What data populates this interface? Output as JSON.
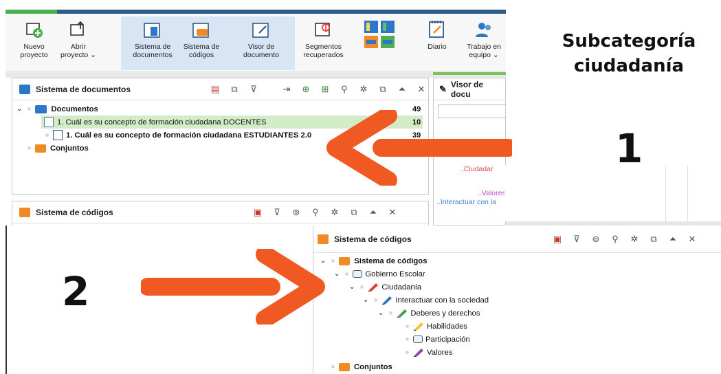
{
  "ribbon": {
    "buttons": [
      {
        "label_1": "Nuevo",
        "label_2": "proyecto",
        "icon": "new-project-icon"
      },
      {
        "label_1": "Abrir",
        "label_2": "proyecto ⌄",
        "icon": "open-project-icon"
      },
      {
        "label_1": "Sistema de",
        "label_2": "documentos",
        "icon": "document-system-icon"
      },
      {
        "label_1": "Sistema de",
        "label_2": "códigos",
        "icon": "code-system-icon"
      },
      {
        "label_1": "Visor de",
        "label_2": "documento",
        "icon": "document-browser-icon"
      },
      {
        "label_1": "Segmentos",
        "label_2": "recuperados",
        "icon": "retrieved-segments-icon"
      },
      {
        "label_1": "",
        "label_2": "",
        "icon": "layout-grid-icon"
      },
      {
        "label_1": "Diario",
        "label_2": "",
        "icon": "logbook-icon"
      },
      {
        "label_1": "Trabajo en",
        "label_2": "equipo ⌄",
        "icon": "teamwork-icon"
      }
    ]
  },
  "doc_panel": {
    "title": "Sistema de documentos",
    "root": {
      "label": "Documentos",
      "count": "49"
    },
    "docs": [
      {
        "label": "1. Cuál es su concepto de formación ciudadana DOCENTES",
        "count": "10"
      },
      {
        "label": "1. Cuál es su concepto de formación ciudadana ESTUDIANTES 2.0",
        "count": "39"
      }
    ],
    "sets": "Conjuntos"
  },
  "viewer_panel": {
    "title": "Visor de docu",
    "snippets": [
      "..Ciudadar",
      "..Valores",
      "..Interactuar con la"
    ]
  },
  "code_panel_top": {
    "title": "Sistema de códigos"
  },
  "code_panel": {
    "title": "Sistema de códigos",
    "root": "Sistema de códigos",
    "items": [
      {
        "label": "Gobierno Escolar"
      },
      {
        "label": "Ciudadanía"
      },
      {
        "label": "Interactuar con la sociedad"
      },
      {
        "label": "Deberes y derechos"
      },
      {
        "label": "Habilidades"
      },
      {
        "label": "Participación"
      },
      {
        "label": "Valores"
      }
    ],
    "sets": "Conjuntos"
  },
  "annotations": {
    "heading_1": "Subcategoría",
    "heading_2": "ciudadanía",
    "step_1": "1",
    "step_2": "2"
  },
  "colors": {
    "arrow": "#f05a22",
    "accent_blue": "#2c77c9",
    "highlight_row": "#d3ecc8"
  }
}
